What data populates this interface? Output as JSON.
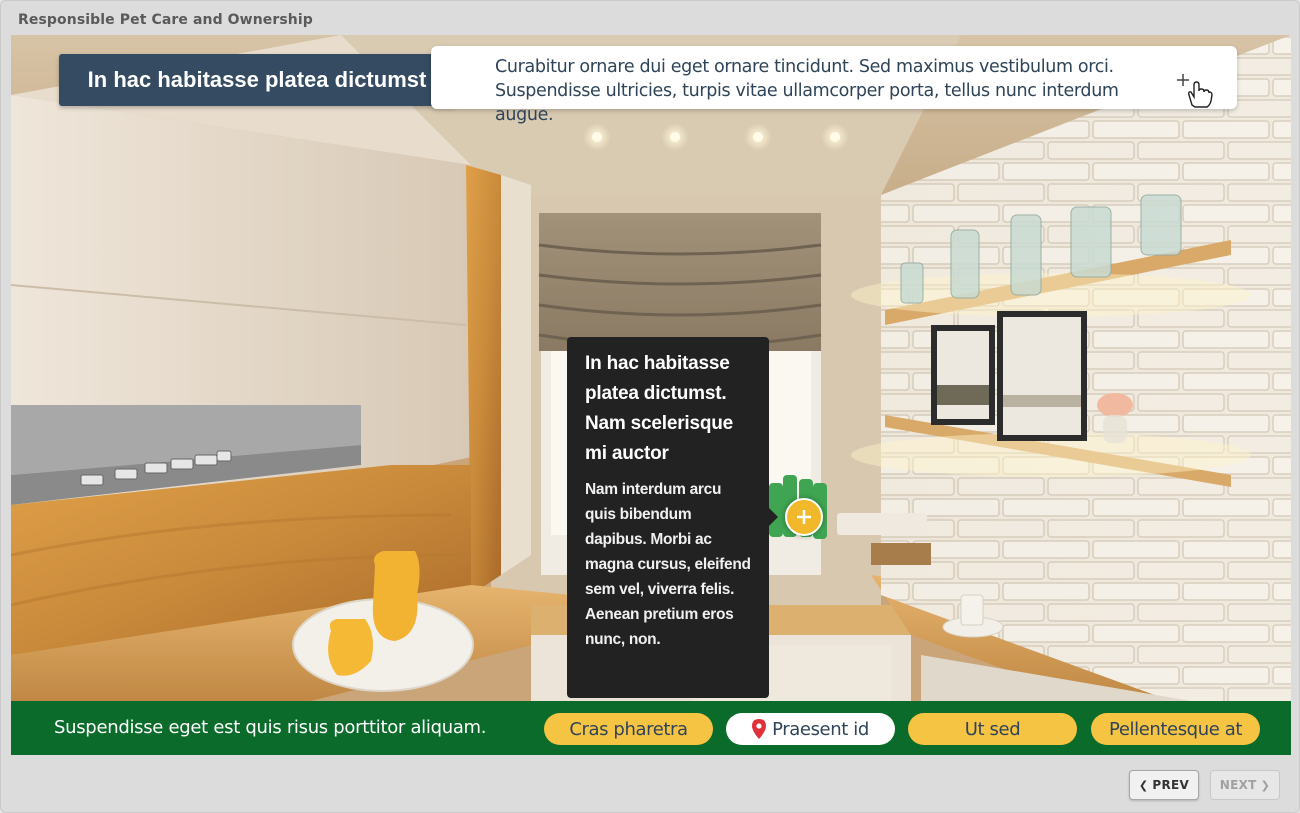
{
  "app": {
    "title": "Responsible Pet Care and Ownership"
  },
  "scene": {
    "title": "In hac habitasse platea dictumst",
    "intro_line1": "Curabitur ornare dui eget ornare tincidunt. Sed maximus vestibulum orci.",
    "intro_line2": "Suspendisse ultricies, turpis vitae ullamcorper porta, tellus nunc interdum augue."
  },
  "tooltip": {
    "title": "In hac habitasse platea dictumst. Nam scelerisque mi auctor",
    "body": "Nam interdum arcu quis bibendum dapibus. Morbi ac magna cursus, eleifend sem vel, viverra felis. Aenean pretium eros nunc, non."
  },
  "bottom_bar": {
    "caption": "Suspendisse eget est quis risus porttitor aliquam.",
    "buttons": [
      {
        "label": "Cras pharetra",
        "active": false
      },
      {
        "label": "Praesent id",
        "active": true
      },
      {
        "label": "Ut sed",
        "active": false
      },
      {
        "label": "Pellentesque at",
        "active": false
      }
    ]
  },
  "nav": {
    "prev": "PREV",
    "next": "NEXT"
  },
  "colors": {
    "banner": "#344b62",
    "bottom_bar": "#0a6b2b",
    "pill": "#f6c443",
    "hotspot": "#f2b82b",
    "tooltip": "#222222",
    "pin": "#e2303a"
  },
  "icons": {
    "hotspot": "plus-icon",
    "cursor": "hand-pointer-icon",
    "pin": "map-pin-icon"
  }
}
